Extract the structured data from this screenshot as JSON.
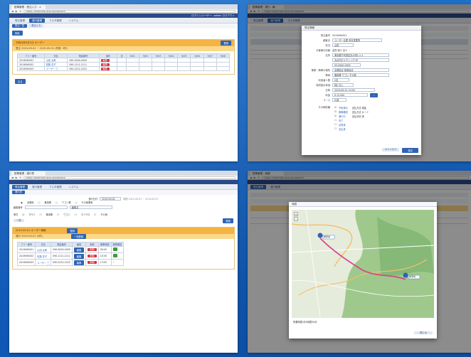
{
  "s1": {
    "tab": "配車管理 - 受注入力 - ×",
    "url": "https://example-app.jp/dispatch",
    "user": "ログインユーザー：admin  ログアウト",
    "menus": [
      "受注管理",
      "運行管理",
      "マスタ管理",
      "システム"
    ],
    "sub": [
      "受注一覧",
      "受注入力"
    ],
    "search_label": "検索",
    "orange_title": "令和元年9月1日  オーダー",
    "orange_btn": "登録",
    "orange2": "受注 2019-09-01 ~ 2019-09-01 (件数: 3件)",
    "headers": [
      "フリー番号",
      "氏名",
      "電話番号",
      "操作",
      "月",
      "9/01",
      "9/02",
      "9/03",
      "9/04",
      "9/05",
      "9/06",
      "9/07",
      "9/08"
    ],
    "rows": [
      {
        "id": "2019090001",
        "name": "山田 太郎",
        "tel": "090-0000-0000"
      },
      {
        "id": "2019090002",
        "name": "佐藤 花子",
        "tel": "090-1111-1111"
      },
      {
        "id": "2019090003",
        "name": "ユーザー 三",
        "tel": "090-2222-2222"
      }
    ],
    "op": "編集",
    "footer_btn": "戻る"
  },
  "s2": {
    "tab": "配車管理 - 運行 - 編",
    "menus": [
      "受注管理",
      "運行管理",
      "マスタ管理"
    ],
    "modal_title": "受注情報",
    "fields": [
      {
        "label": "受注番号",
        "value": "2019090001"
      },
      {
        "label": "顧客名",
        "value": "ユーザー企業 本社営業所"
      },
      {
        "label": "担当",
        "value": "山田"
      },
      {
        "label": "お客様の情報",
        "value": "会員  個人  法人"
      },
      {
        "label": "住所",
        "value": "東京都千代田区丸の内1-1-1"
      },
      {
        "label": "",
        "value": "丸の内ビルディング 5F"
      },
      {
        "label": "",
        "value": "03-0000-0000"
      },
      {
        "label": "乗車・降車の場所",
        "value": "出発地点    到着地点"
      },
      {
        "label": "車両",
        "value": "乗用車    ワゴン    その他"
      },
      {
        "label": "利用者人数",
        "value": "2名"
      },
      {
        "label": "特別指示事項",
        "value": "特になし"
      },
      {
        "label": "日時",
        "value": "2019-09-01  10:00"
      },
      {
        "label": "料金",
        "value": "¥ 12,000"
      },
      {
        "label": "",
        "value": ""
      },
      {
        "label": "コース",
        "value": "片道"
      },
      {
        "label": "その他情報",
        "value": "チェック項目"
      }
    ],
    "checks": [
      "予約済み",
      "乗車確認",
      "運行中",
      "完了",
      "請求済",
      "支払済"
    ],
    "right": [
      "支払方法  現金",
      "支払方法  カード",
      "支払状況  済"
    ],
    "cancel": "キャンセル",
    "save": "保存"
  },
  "s3": {
    "tab": "配車管理 - 運行表",
    "menus": [
      "受注管理",
      "運行管理",
      "マスタ管理",
      "システム"
    ],
    "sub": [
      "運行表"
    ],
    "date_label": "運行日付",
    "date_value": "2019-09-01",
    "date_range": "期間  2019-09-01 ~ 2019-09-07",
    "radio": [
      "全車両",
      "乗用車",
      "ワゴン車",
      "その他車両"
    ],
    "customer_label": "顧客番号",
    "customer_value": "顧客名",
    "cond_label": "条件",
    "cond": [
      "すべて",
      "乗用車",
      "ワゴン",
      "マイクロ",
      "その他"
    ],
    "search": "検索",
    "tag": "一覧",
    "orange_title": "2019-09-01  オーダー情報",
    "orange_btn": "登録",
    "orange2": "運行  2019-09-01 (3件)",
    "orange2_btn": "一括登録",
    "headers": [
      "フリー番号",
      "氏名",
      "電話番号",
      "編集",
      "削除",
      "乗車時間",
      "乗車確認"
    ],
    "rows": [
      {
        "id": "2019090001",
        "name": "山田 太郎",
        "tel": "090-0000-0000",
        "time": "09:00"
      },
      {
        "id": "2019090002",
        "name": "佐藤 花子",
        "tel": "090-1111-1111",
        "time": "10:30"
      },
      {
        "id": "2019090003",
        "name": "ユーザー 三",
        "tel": "090-2222-2222",
        "time": "13:00"
      }
    ],
    "edit": "編集",
    "del": "削除"
  },
  "s4": {
    "tab": "配車管理 - 地図",
    "map_title": "地図",
    "markers": [
      "乗車地",
      "降車地"
    ],
    "caption": "所要時間 約1時間30分",
    "close": "閉じる"
  }
}
